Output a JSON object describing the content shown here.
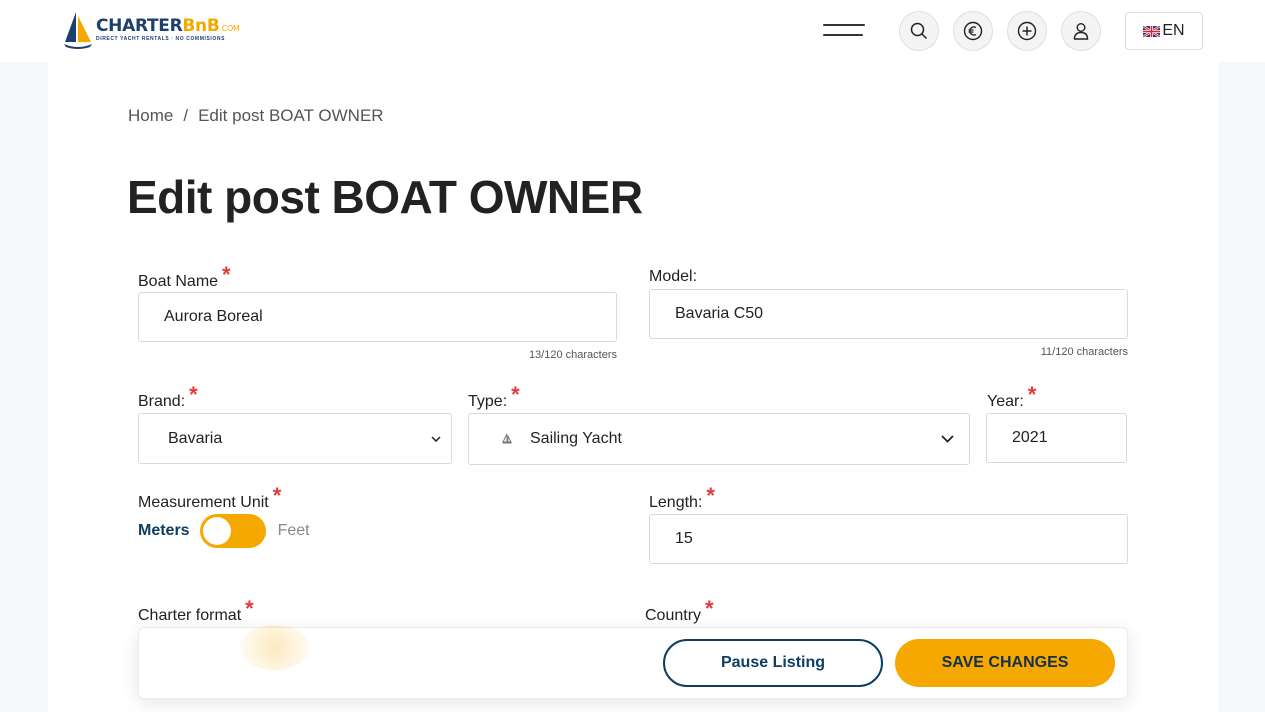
{
  "header": {
    "logo": {
      "main_charter": "CHARTER",
      "main_bnb": "BnB",
      "main_com": ".COM",
      "tagline": "DIRECT YACHT RENTALS · NO COMMISIONS"
    },
    "icons": [
      "menu-icon",
      "search-icon",
      "euro-icon",
      "plus-circle-icon",
      "user-icon"
    ],
    "language": "EN"
  },
  "breadcrumb": {
    "home": "Home",
    "separator": "/",
    "current": "Edit post BOAT OWNER"
  },
  "page_title": "Edit post BOAT OWNER",
  "form": {
    "boat_name": {
      "label": "Boat Name",
      "required": "*",
      "value": "Aurora Boreal",
      "counter": "13/120 characters"
    },
    "model": {
      "label": "Model:",
      "value": "Bavaria C50",
      "counter": "11/120 characters"
    },
    "brand": {
      "label": "Brand:",
      "required": "*",
      "value": "Bavaria"
    },
    "type": {
      "label": "Type:",
      "required": "*",
      "value": "Sailing Yacht",
      "icon": "sailboat-icon"
    },
    "year": {
      "label": "Year:",
      "required": "*",
      "value": "2021"
    },
    "measurement_unit": {
      "label": "Measurement Unit",
      "required": "*",
      "option_on": "Meters",
      "option_off": "Feet"
    },
    "length": {
      "label": "Length:",
      "required": "*",
      "value": "15"
    },
    "charter_format": {
      "label": "Charter format",
      "required": "*"
    },
    "country": {
      "label": "Country",
      "required": "*"
    }
  },
  "actions": {
    "pause": "Pause Listing",
    "save": "SAVE CHANGES"
  },
  "colors": {
    "accent": "#f5a800",
    "navy": "#0e3e63",
    "required": "#e23b3b"
  }
}
